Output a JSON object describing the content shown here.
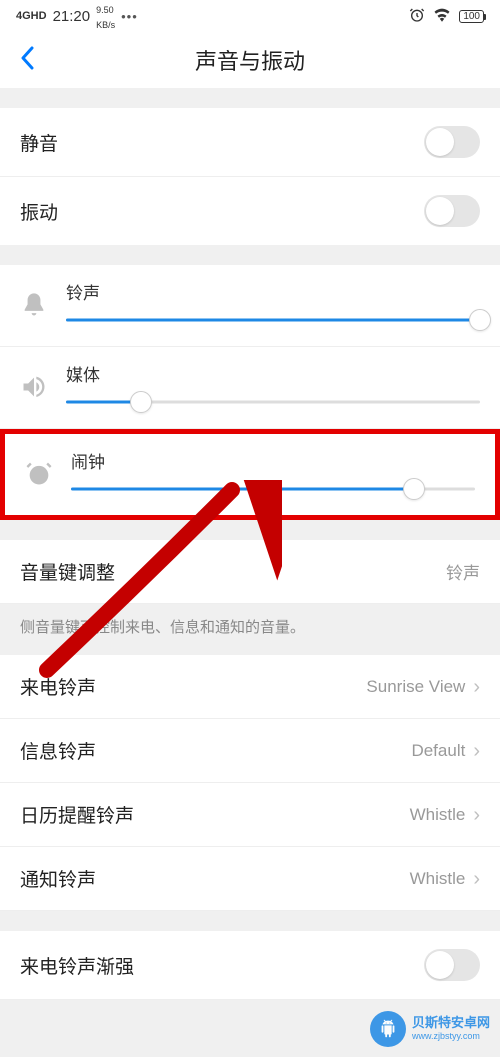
{
  "status": {
    "signal": "4GHD",
    "time": "21:20",
    "kbs_top": "9.50",
    "kbs_bot": "KB/s",
    "dots": "•••",
    "battery": "100"
  },
  "header": {
    "title": "声音与振动"
  },
  "toggles": {
    "mute": "静音",
    "vibrate": "振动"
  },
  "sliders": {
    "ringtone": {
      "label": "铃声",
      "percent": 100
    },
    "media": {
      "label": "媒体",
      "percent": 18
    },
    "alarm": {
      "label": "闹钟",
      "percent": 85
    }
  },
  "volume_key": {
    "label": "音量键调整",
    "value": "铃声",
    "desc": "侧音量键可控制来电、信息和通知的音量。"
  },
  "nav": {
    "incoming": {
      "label": "来电铃声",
      "value": "Sunrise View"
    },
    "message": {
      "label": "信息铃声",
      "value": "Default"
    },
    "calendar": {
      "label": "日历提醒铃声",
      "value": "Whistle"
    },
    "notify": {
      "label": "通知铃声",
      "value": "Whistle"
    }
  },
  "crescendo": {
    "label": "来电铃声渐强"
  },
  "watermark": {
    "cn": "贝斯特安卓网",
    "en": "www.zjbstyy.com"
  }
}
